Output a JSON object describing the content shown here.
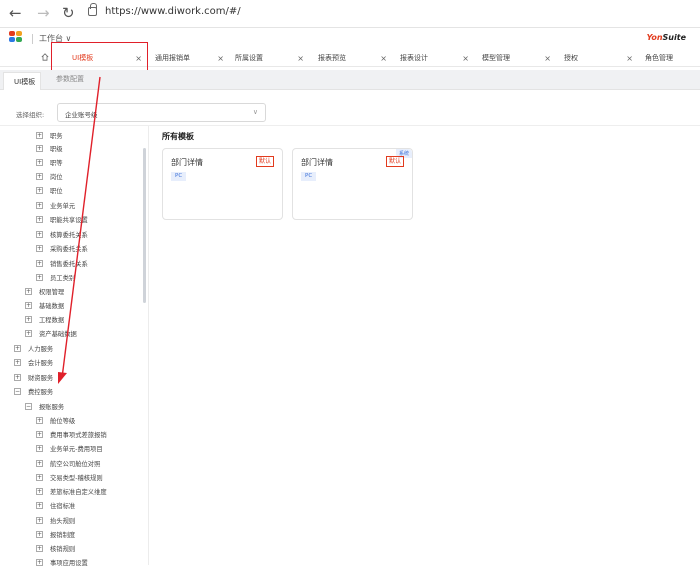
{
  "browser": {
    "back": "←",
    "forward": "→",
    "refresh": "↻",
    "url": "https://www.diwork.com/#/"
  },
  "app": {
    "workbench": "工作台 ∨",
    "brand_a": "Yon",
    "brand_b": "Suite"
  },
  "tabs": [
    {
      "label": "UI模板",
      "active": true
    },
    {
      "label": "通用报销单",
      "active": false
    },
    {
      "label": "所属设置",
      "active": false
    },
    {
      "label": "报表预览",
      "active": false
    },
    {
      "label": "报表设计",
      "active": false
    },
    {
      "label": "模型管理",
      "active": false
    },
    {
      "label": "授权",
      "active": false
    },
    {
      "label": "角色管理",
      "active": false
    }
  ],
  "close_glyph": "×",
  "subtabs": {
    "ui": "UI模板",
    "params": "参数配置"
  },
  "org": {
    "label": "选择组织:",
    "value": "企业账号级",
    "chevron": "∨"
  },
  "tree": [
    {
      "sign": "+",
      "label": "职务"
    },
    {
      "sign": "+",
      "label": "职级"
    },
    {
      "sign": "+",
      "label": "职等"
    },
    {
      "sign": "+",
      "label": "岗位"
    },
    {
      "sign": "+",
      "label": "职位"
    },
    {
      "sign": "+",
      "label": "业务单元"
    },
    {
      "sign": "+",
      "label": "职能共享设置"
    },
    {
      "sign": "+",
      "label": "核算委托关系"
    },
    {
      "sign": "+",
      "label": "采购委托关系"
    },
    {
      "sign": "+",
      "label": "销售委托关系"
    },
    {
      "sign": "+",
      "label": "员工类别"
    },
    {
      "sign": "+",
      "label": "权限管理"
    },
    {
      "sign": "+",
      "label": "基础数据"
    },
    {
      "sign": "+",
      "label": "工程数据"
    },
    {
      "sign": "+",
      "label": "资产基础数据"
    },
    {
      "sign": "+",
      "label": "人力服务"
    },
    {
      "sign": "+",
      "label": "会计服务"
    },
    {
      "sign": "+",
      "label": "财资服务"
    },
    {
      "sign": "−",
      "label": "费控服务"
    },
    {
      "sign": "−",
      "label": "报账服务"
    },
    {
      "sign": "+",
      "label": "舱位等级"
    },
    {
      "sign": "+",
      "label": "费用事项式差旅报销"
    },
    {
      "sign": "+",
      "label": "业务单元-费用项目"
    },
    {
      "sign": "+",
      "label": "航空公司舱位对照"
    },
    {
      "sign": "+",
      "label": "交易类型-稽核规则"
    },
    {
      "sign": "+",
      "label": "差旅标准自定义维度"
    },
    {
      "sign": "+",
      "label": "住宿标准"
    },
    {
      "sign": "+",
      "label": "抬头规则"
    },
    {
      "sign": "+",
      "label": "报销制度"
    },
    {
      "sign": "+",
      "label": "核销规则"
    },
    {
      "sign": "+",
      "label": "事项应用设置"
    }
  ],
  "main": {
    "title": "所有模板",
    "cards": [
      {
        "name": "部门详情",
        "default": "默认",
        "platform": "PC",
        "corner": ""
      },
      {
        "name": "部门详情",
        "default": "默认",
        "platform": "PC",
        "corner": "系统"
      }
    ]
  },
  "colors": {
    "accent": "#e23b1e",
    "highlight": "#e0202a",
    "blue": "#3a6fd8"
  }
}
